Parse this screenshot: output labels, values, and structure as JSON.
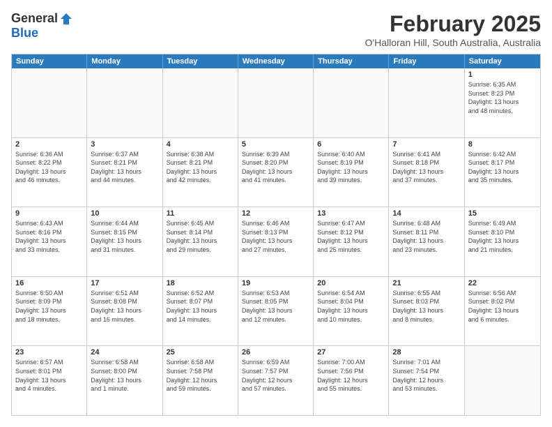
{
  "logo": {
    "general": "General",
    "blue": "Blue"
  },
  "title": "February 2025",
  "location": "O'Halloran Hill, South Australia, Australia",
  "days_of_week": [
    "Sunday",
    "Monday",
    "Tuesday",
    "Wednesday",
    "Thursday",
    "Friday",
    "Saturday"
  ],
  "weeks": [
    [
      {
        "day": "",
        "info": ""
      },
      {
        "day": "",
        "info": ""
      },
      {
        "day": "",
        "info": ""
      },
      {
        "day": "",
        "info": ""
      },
      {
        "day": "",
        "info": ""
      },
      {
        "day": "",
        "info": ""
      },
      {
        "day": "1",
        "info": "Sunrise: 6:35 AM\nSunset: 8:23 PM\nDaylight: 13 hours\nand 48 minutes."
      }
    ],
    [
      {
        "day": "2",
        "info": "Sunrise: 6:36 AM\nSunset: 8:22 PM\nDaylight: 13 hours\nand 46 minutes."
      },
      {
        "day": "3",
        "info": "Sunrise: 6:37 AM\nSunset: 8:21 PM\nDaylight: 13 hours\nand 44 minutes."
      },
      {
        "day": "4",
        "info": "Sunrise: 6:38 AM\nSunset: 8:21 PM\nDaylight: 13 hours\nand 42 minutes."
      },
      {
        "day": "5",
        "info": "Sunrise: 6:39 AM\nSunset: 8:20 PM\nDaylight: 13 hours\nand 41 minutes."
      },
      {
        "day": "6",
        "info": "Sunrise: 6:40 AM\nSunset: 8:19 PM\nDaylight: 13 hours\nand 39 minutes."
      },
      {
        "day": "7",
        "info": "Sunrise: 6:41 AM\nSunset: 8:18 PM\nDaylight: 13 hours\nand 37 minutes."
      },
      {
        "day": "8",
        "info": "Sunrise: 6:42 AM\nSunset: 8:17 PM\nDaylight: 13 hours\nand 35 minutes."
      }
    ],
    [
      {
        "day": "9",
        "info": "Sunrise: 6:43 AM\nSunset: 8:16 PM\nDaylight: 13 hours\nand 33 minutes."
      },
      {
        "day": "10",
        "info": "Sunrise: 6:44 AM\nSunset: 8:15 PM\nDaylight: 13 hours\nand 31 minutes."
      },
      {
        "day": "11",
        "info": "Sunrise: 6:45 AM\nSunset: 8:14 PM\nDaylight: 13 hours\nand 29 minutes."
      },
      {
        "day": "12",
        "info": "Sunrise: 6:46 AM\nSunset: 8:13 PM\nDaylight: 13 hours\nand 27 minutes."
      },
      {
        "day": "13",
        "info": "Sunrise: 6:47 AM\nSunset: 8:12 PM\nDaylight: 13 hours\nand 25 minutes."
      },
      {
        "day": "14",
        "info": "Sunrise: 6:48 AM\nSunset: 8:11 PM\nDaylight: 13 hours\nand 23 minutes."
      },
      {
        "day": "15",
        "info": "Sunrise: 6:49 AM\nSunset: 8:10 PM\nDaylight: 13 hours\nand 21 minutes."
      }
    ],
    [
      {
        "day": "16",
        "info": "Sunrise: 6:50 AM\nSunset: 8:09 PM\nDaylight: 13 hours\nand 18 minutes."
      },
      {
        "day": "17",
        "info": "Sunrise: 6:51 AM\nSunset: 8:08 PM\nDaylight: 13 hours\nand 16 minutes."
      },
      {
        "day": "18",
        "info": "Sunrise: 6:52 AM\nSunset: 8:07 PM\nDaylight: 13 hours\nand 14 minutes."
      },
      {
        "day": "19",
        "info": "Sunrise: 6:53 AM\nSunset: 8:05 PM\nDaylight: 13 hours\nand 12 minutes."
      },
      {
        "day": "20",
        "info": "Sunrise: 6:54 AM\nSunset: 8:04 PM\nDaylight: 13 hours\nand 10 minutes."
      },
      {
        "day": "21",
        "info": "Sunrise: 6:55 AM\nSunset: 8:03 PM\nDaylight: 13 hours\nand 8 minutes."
      },
      {
        "day": "22",
        "info": "Sunrise: 6:56 AM\nSunset: 8:02 PM\nDaylight: 13 hours\nand 6 minutes."
      }
    ],
    [
      {
        "day": "23",
        "info": "Sunrise: 6:57 AM\nSunset: 8:01 PM\nDaylight: 13 hours\nand 4 minutes."
      },
      {
        "day": "24",
        "info": "Sunrise: 6:58 AM\nSunset: 8:00 PM\nDaylight: 13 hours\nand 1 minute."
      },
      {
        "day": "25",
        "info": "Sunrise: 6:58 AM\nSunset: 7:58 PM\nDaylight: 12 hours\nand 59 minutes."
      },
      {
        "day": "26",
        "info": "Sunrise: 6:59 AM\nSunset: 7:57 PM\nDaylight: 12 hours\nand 57 minutes."
      },
      {
        "day": "27",
        "info": "Sunrise: 7:00 AM\nSunset: 7:56 PM\nDaylight: 12 hours\nand 55 minutes."
      },
      {
        "day": "28",
        "info": "Sunrise: 7:01 AM\nSunset: 7:54 PM\nDaylight: 12 hours\nand 53 minutes."
      },
      {
        "day": "",
        "info": ""
      }
    ]
  ]
}
